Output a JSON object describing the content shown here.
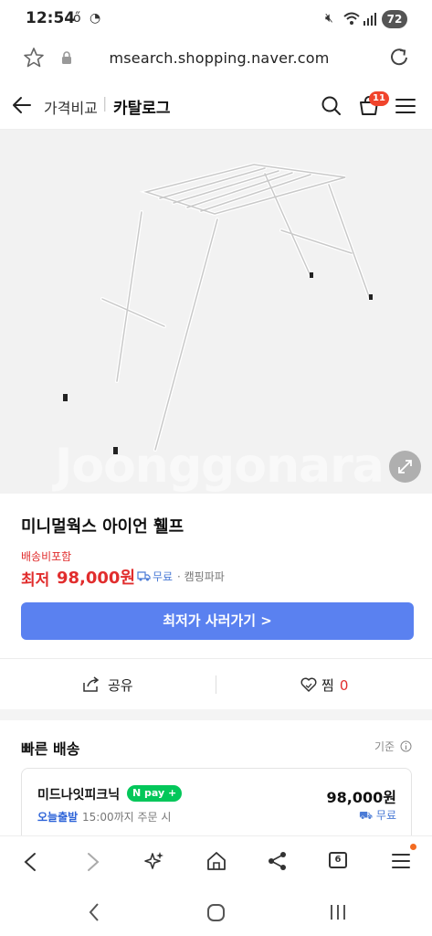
{
  "status_bar": {
    "time": "12:54",
    "battery": "72",
    "icons": [
      "app-notification-icon",
      "sync-icon",
      "mute-icon",
      "wifi-icon",
      "signal-icon"
    ]
  },
  "browser": {
    "url": "msearch.shopping.naver.com",
    "left_icons": [
      "star-icon",
      "lock-icon"
    ],
    "right_icon": "reload-icon"
  },
  "header": {
    "crumb_compare": "가격비교",
    "crumb_catalog": "카탈로그",
    "cart_count": "11"
  },
  "product": {
    "watermark": "Joonggonara",
    "title": "미니멀웍스 아이언 휄프",
    "shipping_note": "배송비포함",
    "lowest_label": "최저",
    "lowest_price": "98,000원",
    "free_shipping": "무료",
    "seller": "· 캠핑파파",
    "buy_button": "최저가 사러가기 >"
  },
  "actions": {
    "share": "공유",
    "like": "찜",
    "like_count": "0"
  },
  "fast_delivery": {
    "heading": "빠른 배송",
    "basis": "기준",
    "item": {
      "name": "미드나잇피크닉",
      "npay": "pay",
      "price": "98,000원",
      "departure": "오늘출발",
      "cutoff": "15:00까지 주문 시",
      "shipping": "무료"
    }
  },
  "toolbar": {
    "tab_count": "6"
  },
  "colors": {
    "accent_red": "#e12d2d",
    "button_blue": "#5a81f0",
    "npay_green": "#03c75a"
  }
}
